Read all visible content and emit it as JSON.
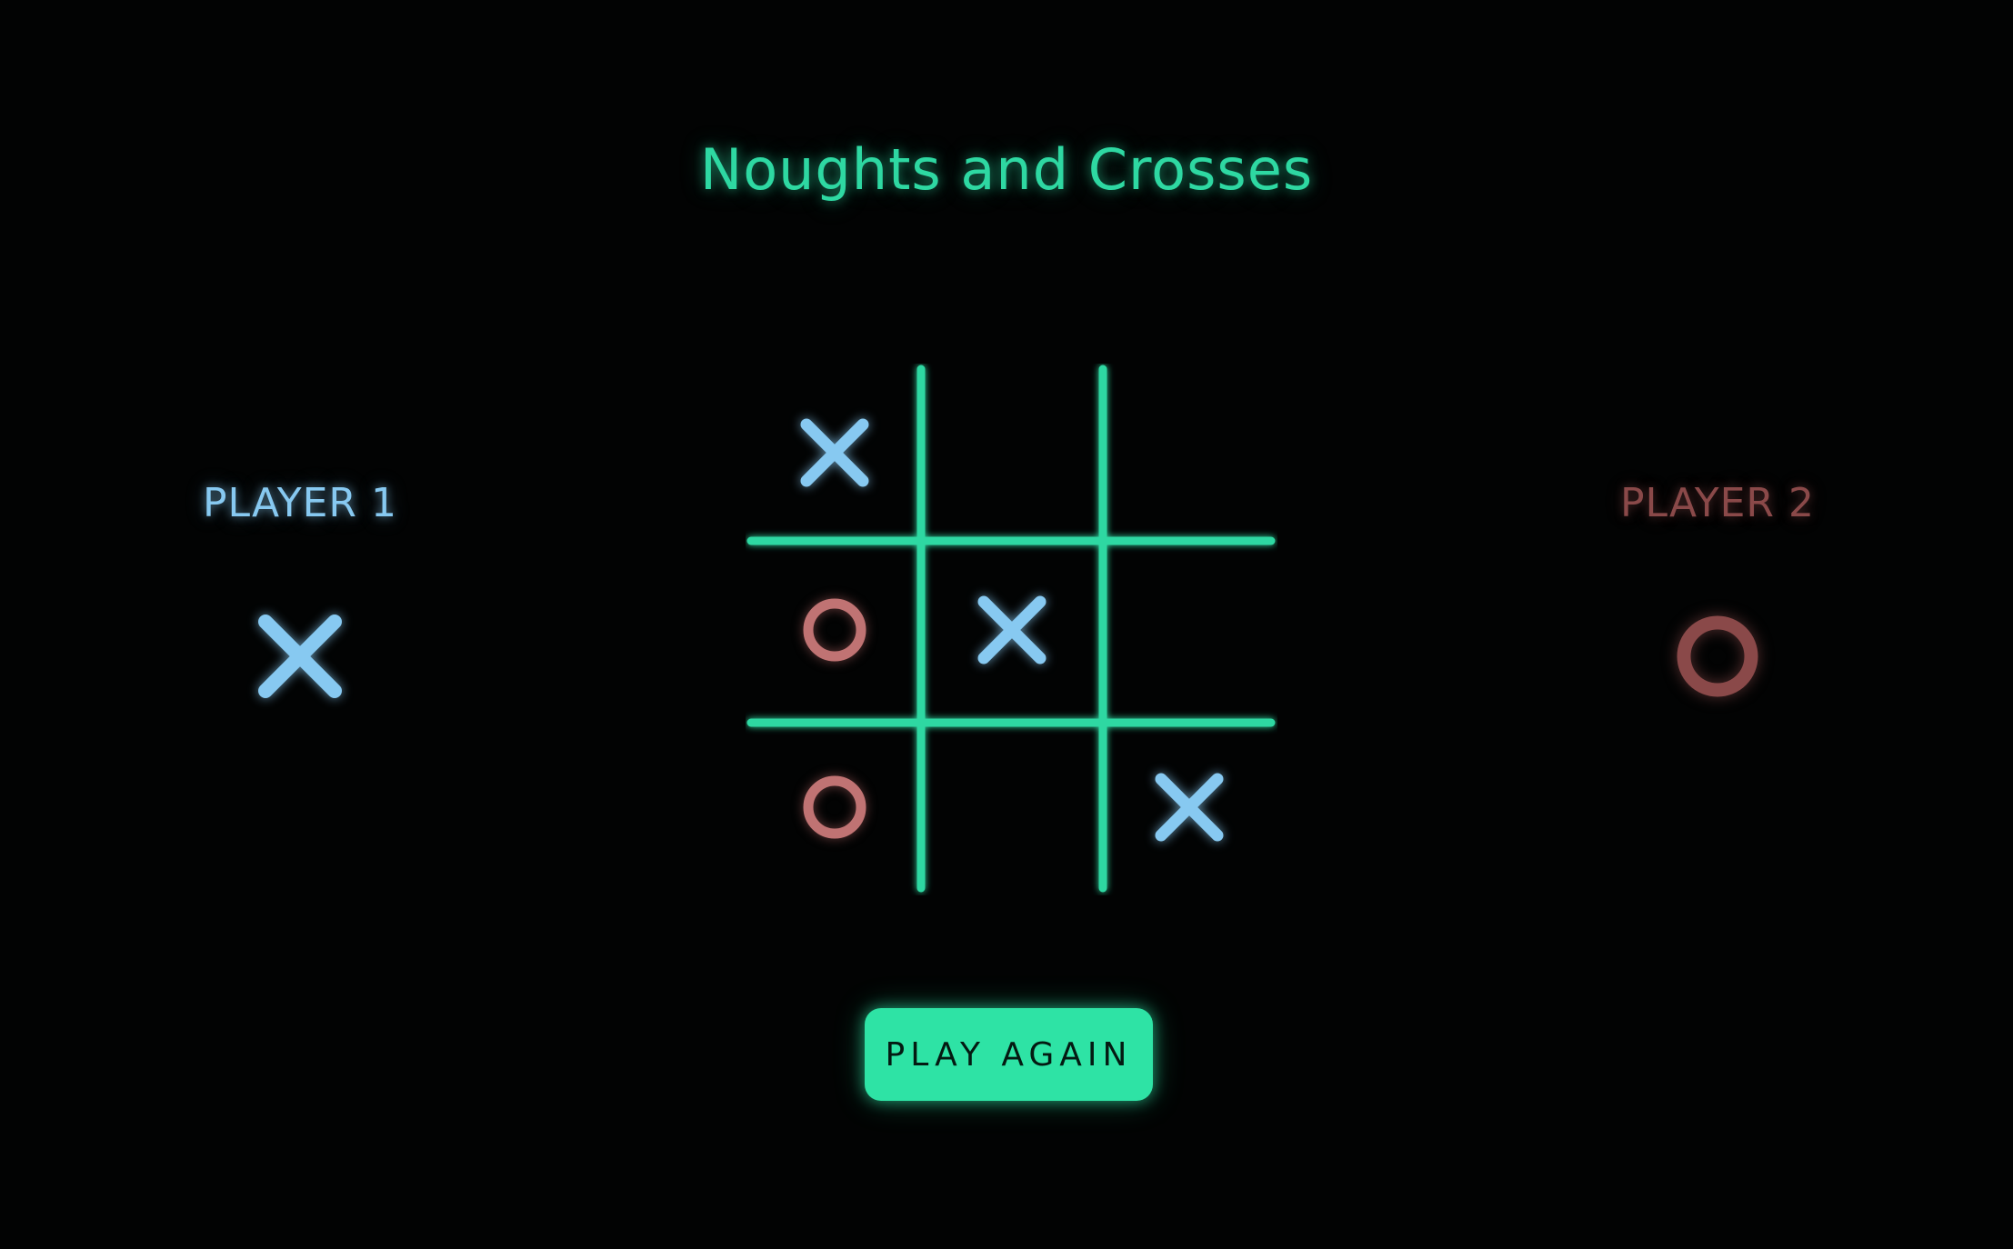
{
  "title": "Noughts and Crosses",
  "players": {
    "p1": {
      "label": "PLAYER 1",
      "mark": "X",
      "color": "#87c9f1"
    },
    "p2": {
      "label": "PLAYER 2",
      "mark": "O",
      "color": "#8a4949"
    }
  },
  "board": {
    "cells": [
      "X",
      "",
      "",
      "O",
      "X",
      "",
      "O",
      "",
      "X"
    ],
    "line_color": "#2ed8a2",
    "x_color": "#87c9f1",
    "o_color": "#c07373"
  },
  "buttons": {
    "play_again": "PLAY AGAIN"
  },
  "icons": {
    "x": "cross-icon",
    "o": "nought-icon"
  }
}
